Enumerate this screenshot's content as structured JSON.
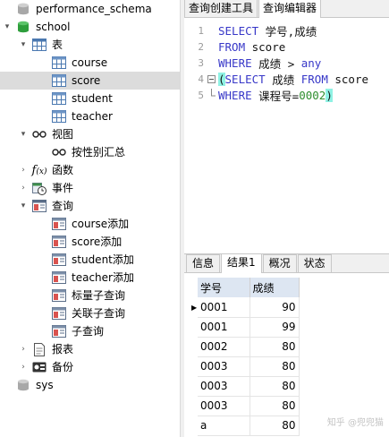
{
  "tree": {
    "performance_schema": "performance_schema",
    "school": "school",
    "tables_group": "表",
    "tables": [
      "course",
      "score",
      "student",
      "teacher"
    ],
    "views_group": "视图",
    "views": [
      "按性别汇总"
    ],
    "functions_group": "函数",
    "events_group": "事件",
    "queries_group": "查询",
    "queries": [
      "course添加",
      "score添加",
      "student添加",
      "teacher添加",
      "标量子查询",
      "关联子查询",
      "子查询"
    ],
    "reports_group": "报表",
    "backups_group": "备份",
    "sys": "sys",
    "selected": "score"
  },
  "top_tabs": [
    "查询创建工具",
    "查询编辑器"
  ],
  "active_top_tab": "查询编辑器",
  "editor": {
    "line_numbers": [
      "1",
      "2",
      "3",
      "4",
      "5"
    ],
    "line1": {
      "kw": "SELECT",
      "rest": " 学号,成绩"
    },
    "line2": {
      "kw": "FROM",
      "rest": " score"
    },
    "line3": {
      "kw": "WHERE",
      "rest": " 成绩 > ",
      "kw2": "any"
    },
    "line4": {
      "open": "(",
      "kw": "SELECT",
      "rest": " 成绩 ",
      "kw2": "FROM",
      "rest2": " score"
    },
    "line5": {
      "kw": "WHERE",
      "rest": " 课程号=",
      "num": "0002",
      "close": ")"
    }
  },
  "result_tabs": [
    "信息",
    "结果1",
    "概况",
    "状态"
  ],
  "active_result_tab": "结果1",
  "grid": {
    "columns": [
      "学号",
      "成绩"
    ],
    "rows": [
      [
        "0001",
        "90"
      ],
      [
        "0001",
        "99"
      ],
      [
        "0002",
        "80"
      ],
      [
        "0003",
        "80"
      ],
      [
        "0003",
        "80"
      ],
      [
        "0003",
        "80"
      ],
      [
        "a",
        "80"
      ]
    ]
  },
  "watermark": "知乎 @兜兜猫",
  "colors": {
    "keyword": "#3838c8",
    "number": "#2f8f2f",
    "bracket_highlight": "#8ff2e4",
    "selection": "#dcdcdc",
    "header": "#dde6f2"
  }
}
